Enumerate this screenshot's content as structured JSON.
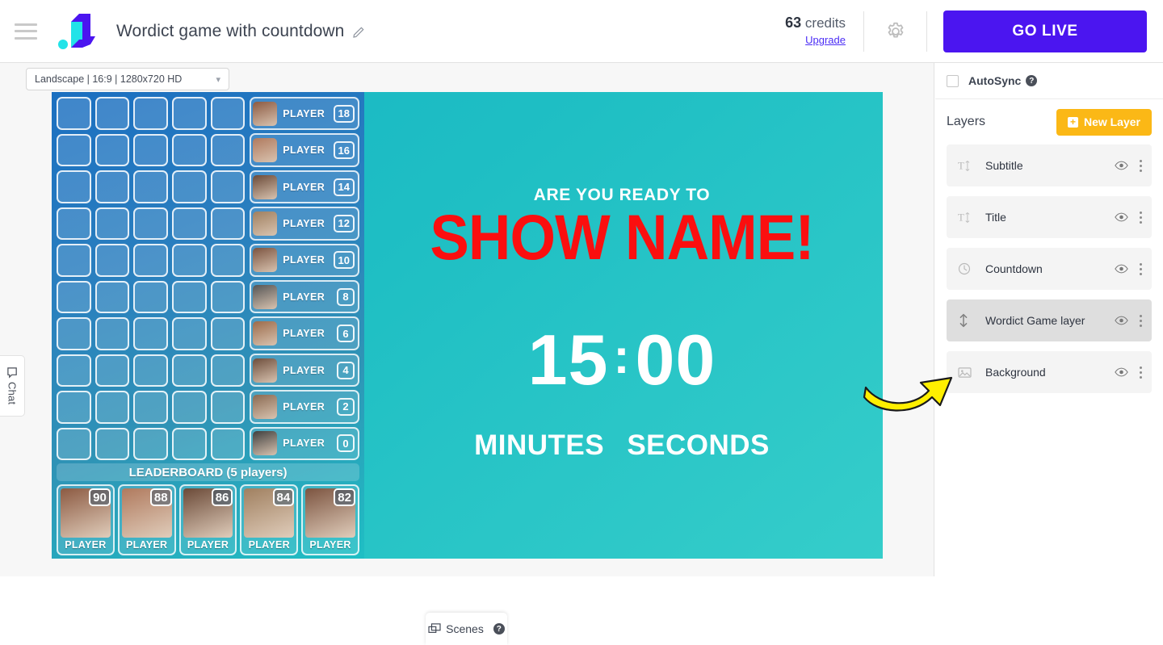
{
  "header": {
    "menu_icon": "hamburger-icon",
    "logo_icon": "lightstream-logo",
    "project_title": "Wordict game with countdown",
    "edit_icon": "pencil-icon",
    "credits_count": "63",
    "credits_label": "credits",
    "upgrade_label": "Upgrade",
    "settings_icon": "gear-icon",
    "go_live_label": "GO LIVE"
  },
  "editor": {
    "ratio_value": "Landscape | 16:9 | 1280x720 HD",
    "ratio_caret": "chevron-down-icon",
    "chat_tab_label": "Chat",
    "chat_tab_icon": "chat-bubble-icon",
    "scenes_label": "Scenes",
    "scenes_icon": "scenes-icon",
    "scenes_help_icon": "help-icon",
    "annotation_icon": "yellow-curved-arrow"
  },
  "canvas": {
    "subtitle": "ARE YOU READY TO",
    "title": "SHOW NAME!",
    "countdown": {
      "minutes": "15",
      "separator": ":",
      "seconds": "00"
    },
    "labels": {
      "minutes": "MINUTES",
      "seconds": "SECONDS"
    },
    "game": {
      "grid": {
        "columns": 5,
        "rows": 10
      },
      "players": [
        {
          "name": "PLAYER",
          "score": "18"
        },
        {
          "name": "PLAYER",
          "score": "16"
        },
        {
          "name": "PLAYER",
          "score": "14"
        },
        {
          "name": "PLAYER",
          "score": "12"
        },
        {
          "name": "PLAYER",
          "score": "10"
        },
        {
          "name": "PLAYER",
          "score": "8"
        },
        {
          "name": "PLAYER",
          "score": "6"
        },
        {
          "name": "PLAYER",
          "score": "4"
        },
        {
          "name": "PLAYER",
          "score": "2"
        },
        {
          "name": "PLAYER",
          "score": "0"
        }
      ],
      "leaderboard_title": "LEADERBOARD (5 players)",
      "leaderboard": [
        {
          "name": "PLAYER",
          "score": "90"
        },
        {
          "name": "PLAYER",
          "score": "88"
        },
        {
          "name": "PLAYER",
          "score": "86"
        },
        {
          "name": "PLAYER",
          "score": "84"
        },
        {
          "name": "PLAYER",
          "score": "82"
        }
      ]
    }
  },
  "right_panel": {
    "autosync_label": "AutoSync",
    "autosync_checked": false,
    "autosync_help_icon": "help-icon",
    "layers_title": "Layers",
    "new_layer_label": "New Layer",
    "new_layer_icon": "plus-icon",
    "layers": [
      {
        "name": "Subtitle",
        "icon": "text-icon",
        "selected": false,
        "visibility_icon": "eye-icon",
        "menu_icon": "kebab-menu-icon"
      },
      {
        "name": "Title",
        "icon": "text-icon",
        "selected": false,
        "visibility_icon": "eye-icon",
        "menu_icon": "kebab-menu-icon"
      },
      {
        "name": "Countdown",
        "icon": "clock-icon",
        "selected": false,
        "visibility_icon": "eye-icon",
        "menu_icon": "kebab-menu-icon"
      },
      {
        "name": "Wordict Game layer",
        "icon": "arrows-vertical-icon",
        "selected": true,
        "visibility_icon": "eye-icon",
        "menu_icon": "kebab-menu-icon"
      },
      {
        "name": "Background",
        "icon": "image-icon",
        "selected": false,
        "visibility_icon": "eye-icon",
        "menu_icon": "kebab-menu-icon"
      }
    ]
  },
  "colors": {
    "brand_purple": "#4b15f0",
    "accent_yellow": "#fbb816",
    "title_red": "#fb0f0f",
    "canvas_teal": "#1fbfc4",
    "game_blue": "#1b6fc0"
  }
}
